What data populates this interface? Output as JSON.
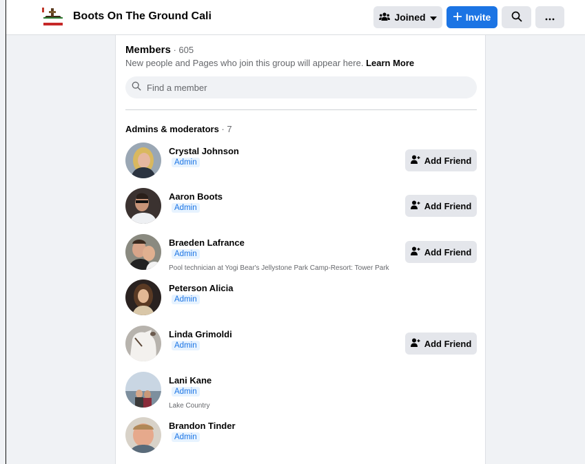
{
  "header": {
    "group_name": "Boots On The Ground Cali",
    "logo_text": "On The Ground",
    "joined_label": "Joined",
    "invite_label": "Invite"
  },
  "members": {
    "title": "Members",
    "count": "605",
    "subtitle": "New people and Pages who join this group will appear here.",
    "learn_more": "Learn More",
    "search_placeholder": "Find a member"
  },
  "admins": {
    "title": "Admins & moderators",
    "count": "7",
    "list": [
      {
        "name": "Crystal Johnson",
        "role": "Admin",
        "description": "",
        "action": "Add Friend"
      },
      {
        "name": "Aaron Boots",
        "role": "Admin",
        "description": "",
        "action": "Add Friend"
      },
      {
        "name": "Braeden Lafrance",
        "role": "Admin",
        "description": "Pool technician at Yogi Bear's Jellystone Park Camp-Resort: Tower Park",
        "action": "Add Friend"
      },
      {
        "name": "Peterson Alicia",
        "role": "Admin",
        "description": "",
        "action": ""
      },
      {
        "name": "Linda Grimoldi",
        "role": "Admin",
        "description": "",
        "action": "Add Friend"
      },
      {
        "name": "Lani Kane",
        "role": "Admin",
        "description": "Lake Country",
        "action": ""
      },
      {
        "name": "Brandon Tinder",
        "role": "Admin",
        "description": "",
        "action": ""
      }
    ]
  },
  "colors": {
    "accent": "#1b74e4",
    "background": "#f0f2f5",
    "button_gray": "#e4e6eb"
  },
  "icons": [
    "group-icon",
    "caret-down-icon",
    "plus-icon",
    "search-icon",
    "more-icon",
    "add-friend-icon"
  ]
}
